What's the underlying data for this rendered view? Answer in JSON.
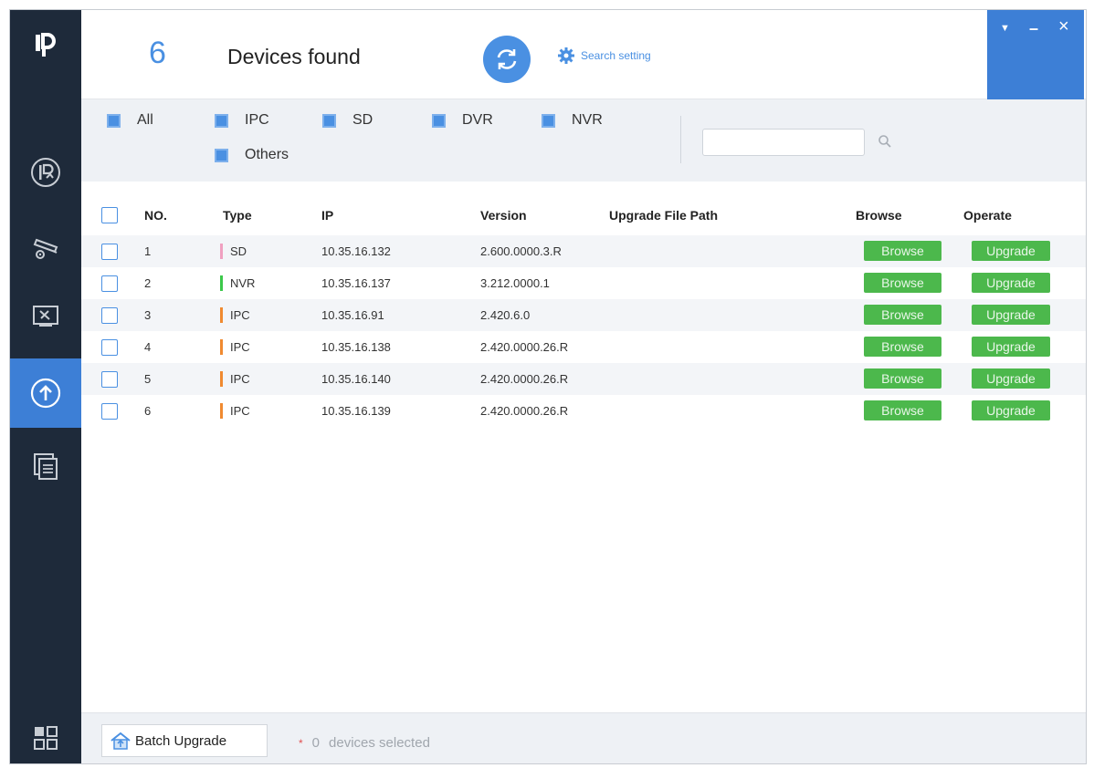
{
  "header": {
    "count": "6",
    "found_label": "Devices found",
    "search_setting_label": "Search setting",
    "window_controls": {
      "menu": "▼",
      "minimize": "–",
      "close": "×"
    }
  },
  "sidebar": {
    "items": [
      {
        "name": "ip-search",
        "icon": "ip-icon"
      },
      {
        "name": "device-config",
        "icon": "camera-icon"
      },
      {
        "name": "system-tools",
        "icon": "tools-icon"
      },
      {
        "name": "upgrade",
        "icon": "upgrade-icon",
        "active": true
      },
      {
        "name": "documents",
        "icon": "document-icon"
      },
      {
        "name": "more",
        "icon": "grid-icon"
      }
    ]
  },
  "filters": {
    "all": "All",
    "ipc": "IPC",
    "sd": "SD",
    "dvr": "DVR",
    "nvr": "NVR",
    "others": "Others",
    "search_placeholder": ""
  },
  "table": {
    "headers": {
      "no": "NO.",
      "type": "Type",
      "ip": "IP",
      "version": "Version",
      "path": "Upgrade File Path",
      "browse": "Browse",
      "operate": "Operate"
    },
    "browse_label": "Browse",
    "upgrade_label": "Upgrade",
    "rows": [
      {
        "no": "1",
        "type": "SD",
        "ip": "10.35.16.132",
        "version": "2.600.0000.3.R",
        "path": "",
        "type_color": "#f0a0c0"
      },
      {
        "no": "2",
        "type": "NVR",
        "ip": "10.35.16.137",
        "version": "3.212.0000.1",
        "path": "",
        "type_color": "#3cc84a"
      },
      {
        "no": "3",
        "type": "IPC",
        "ip": "10.35.16.91",
        "version": "2.420.6.0",
        "path": "",
        "type_color": "#f08a30"
      },
      {
        "no": "4",
        "type": "IPC",
        "ip": "10.35.16.138",
        "version": "2.420.0000.26.R",
        "path": "",
        "type_color": "#f08a30"
      },
      {
        "no": "5",
        "type": "IPC",
        "ip": "10.35.16.140",
        "version": "2.420.0000.26.R",
        "path": "",
        "type_color": "#f08a30"
      },
      {
        "no": "6",
        "type": "IPC",
        "ip": "10.35.16.139",
        "version": "2.420.0000.26.R",
        "path": "",
        "type_color": "#f08a30"
      }
    ]
  },
  "footer": {
    "batch_upgrade": "Batch Upgrade",
    "star": "*",
    "selected_count": "0",
    "selected_label": "devices selected"
  },
  "colors": {
    "sidebar": "#1e2a3a",
    "accent": "#4a90e2",
    "active": "#3d7fd6",
    "button_green": "#4cb84c"
  }
}
